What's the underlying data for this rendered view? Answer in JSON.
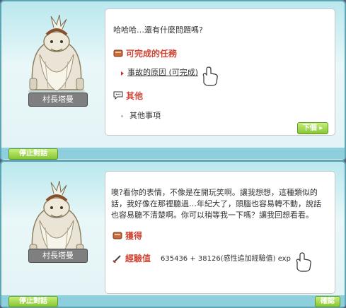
{
  "dialog1": {
    "npc_name": "村長塔曼",
    "greeting": "哈哈哈…還有什麼問題嗎?",
    "available_quests_label": "可完成的任務",
    "quest_item": "事故的原因 (可完成)",
    "other_label": "其他",
    "other_item": "其他事項",
    "next_button": "下個",
    "end_chat_button": "停止對話"
  },
  "dialog2": {
    "npc_name": "村長塔曼",
    "message_line1": "噢?看你的表情，不像是在開玩笑啊。讓我想想，這種類似的",
    "message_line2": "話，我好像在那裡聽過…年紀大了，頭腦也容易轉不動，說話",
    "message_line3": "也容易聽不清楚啊。你可以稍等我一下嗎？讓我回想看看。",
    "reward_label": "獲得",
    "exp_label": "經驗值",
    "exp_value": "635436 + 38126(感性追加經驗值) exp",
    "end_chat_button": "停止對話",
    "confirm_button": "確認"
  }
}
